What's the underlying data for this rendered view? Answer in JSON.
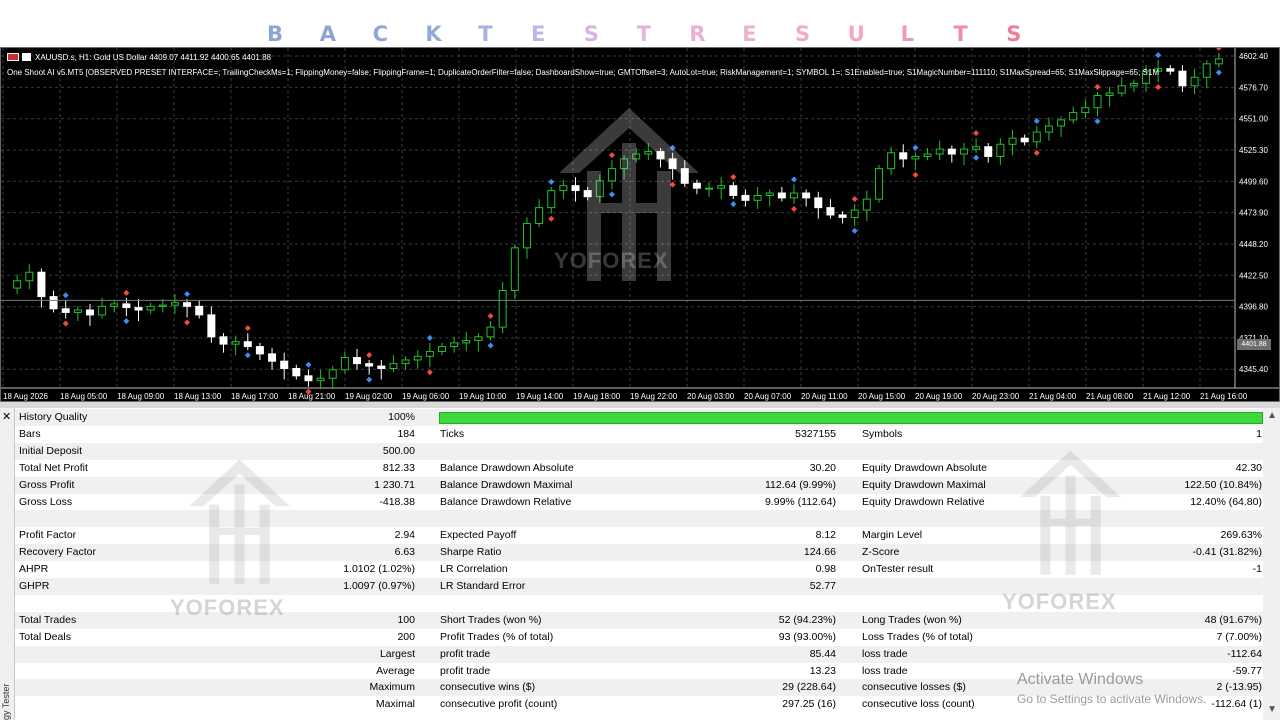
{
  "banner": {
    "letters": [
      "B",
      "A",
      "C",
      "K",
      "T",
      "E",
      "S",
      "T",
      "R",
      "E",
      "S",
      "U",
      "L",
      "T",
      "S"
    ],
    "colors": [
      "#8ba4d4",
      "#8ba4d4",
      "#92a6d8",
      "#9aa7da",
      "#a8b0dc",
      "#c2b4e0",
      "#d6b4e0",
      "#e6b4d8",
      "#eab2d2",
      "#efb0cc",
      "#f2aac6",
      "#f6a6bd",
      "#f39ab0",
      "#ef8ea4",
      "#ec8098"
    ]
  },
  "chart": {
    "symbol_line": "XAUUSD.s, H1:  Gold US Dollar  4409.07 4411.92 4400.65 4401.88",
    "ea_line": "One Shoot AI v5.MT5 [OBSERVED PRESET INTERFACE=; TrailingCheckMs=1; FlippingMoney=false; FlippingFrame=1; DuplicateOrderFilter=false; DashboardShow=true; GMTOffset=3; AutoLot=true; RiskManagement=1; SYMBOL 1=; S1Enabled=true; S1MagicNumber=111110; S1MaxSpread=65; S1MaxSlippage=65; S1M",
    "price_badge": "4401.88",
    "price_ticks": [
      "4602.40",
      "4576.70",
      "4551.00",
      "4525.30",
      "4499.60",
      "4473.90",
      "4448.20",
      "4422.50",
      "4396.80",
      "4371.10",
      "4345.40"
    ],
    "time_ticks": [
      "18 Aug 2026",
      "18 Aug 05:00",
      "18 Aug 09:00",
      "18 Aug 13:00",
      "18 Aug 17:00",
      "18 Aug 21:00",
      "19 Aug 02:00",
      "19 Aug 06:00",
      "19 Aug 10:00",
      "19 Aug 14:00",
      "19 Aug 18:00",
      "19 Aug 22:00",
      "20 Aug 03:00",
      "20 Aug 07:00",
      "20 Aug 11:00",
      "20 Aug 15:00",
      "20 Aug 19:00",
      "20 Aug 23:00",
      "21 Aug 04:00",
      "21 Aug 08:00",
      "21 Aug 12:00",
      "21 Aug 16:00"
    ],
    "watermark": "YOFOREX",
    "candle_close_path": [
      4412,
      4418,
      4425,
      4405,
      4395,
      4392,
      4394,
      4390,
      4397,
      4399,
      4396,
      4394,
      4397,
      4398,
      4400,
      4397,
      4390,
      4372,
      4366,
      4368,
      4364,
      4358,
      4352,
      4346,
      4340,
      4336,
      4338,
      4345,
      4355,
      4350,
      4348,
      4346,
      4350,
      4353,
      4356,
      4360,
      4364,
      4367,
      4369,
      4372,
      4380,
      4410,
      4445,
      4465,
      4478,
      4492,
      4496,
      4492,
      4487,
      4500,
      4510,
      4518,
      4522,
      4524,
      4518,
      4510,
      4498,
      4494,
      4494,
      4496,
      4488,
      4484,
      4488,
      4490,
      4486,
      4490,
      4486,
      4478,
      4472,
      4470,
      4476,
      4485,
      4510,
      4523,
      4518,
      4520,
      4522,
      4526,
      4522,
      4526,
      4528,
      4520,
      4530,
      4535,
      4532,
      4540,
      4545,
      4550,
      4556,
      4560,
      4570,
      4572,
      4578,
      4580,
      4590,
      4592,
      4590,
      4578,
      4585,
      4596,
      4600
    ],
    "colors": {
      "bull": "#22c12a",
      "bear": "#ffffff",
      "grid": "#3a3a3a",
      "buy_marker": "#3a8ef5",
      "sell_marker": "#f04a3a"
    }
  },
  "report": {
    "side_label": "gy Tester",
    "rows": [
      {
        "c1": [
          "History Quality",
          "100%"
        ],
        "c2": [
          "",
          ""
        ],
        "c3": [
          "",
          ""
        ],
        "bar": true
      },
      {
        "c1": [
          "Bars",
          "184"
        ],
        "c2": [
          "Ticks",
          "5327155"
        ],
        "c3": [
          "Symbols",
          "1"
        ]
      },
      {
        "c1": [
          "Initial Deposit",
          "500.00"
        ],
        "c2": [
          "",
          ""
        ],
        "c3": [
          "",
          ""
        ]
      },
      {
        "c1": [
          "Total Net Profit",
          "812.33"
        ],
        "c2": [
          "Balance Drawdown Absolute",
          "30.20"
        ],
        "c3": [
          "Equity Drawdown Absolute",
          "42.30"
        ]
      },
      {
        "c1": [
          "Gross Profit",
          "1 230.71"
        ],
        "c2": [
          "Balance Drawdown Maximal",
          "112.64 (9.99%)"
        ],
        "c3": [
          "Equity Drawdown Maximal",
          "122.50 (10.84%)"
        ]
      },
      {
        "c1": [
          "Gross Loss",
          "-418.38"
        ],
        "c2": [
          "Balance Drawdown Relative",
          "9.99% (112.64)"
        ],
        "c3": [
          "Equity Drawdown Relative",
          "12.40% (64.80)"
        ]
      },
      {
        "c1": [
          "",
          ""
        ],
        "c2": [
          "",
          ""
        ],
        "c3": [
          "",
          ""
        ]
      },
      {
        "c1": [
          "Profit Factor",
          "2.94"
        ],
        "c2": [
          "Expected Payoff",
          "8.12"
        ],
        "c3": [
          "Margin Level",
          "269.63%"
        ]
      },
      {
        "c1": [
          "Recovery Factor",
          "6.63"
        ],
        "c2": [
          "Sharpe Ratio",
          "124.66"
        ],
        "c3": [
          "Z-Score",
          "-0.41 (31.82%)"
        ]
      },
      {
        "c1": [
          "AHPR",
          "1.0102 (1.02%)"
        ],
        "c2": [
          "LR Correlation",
          "0.98"
        ],
        "c3": [
          "OnTester result",
          "-1"
        ]
      },
      {
        "c1": [
          "GHPR",
          "1.0097 (0.97%)"
        ],
        "c2": [
          "LR Standard Error",
          "52.77"
        ],
        "c3": [
          "",
          ""
        ]
      },
      {
        "c1": [
          "",
          ""
        ],
        "c2": [
          "",
          ""
        ],
        "c3": [
          "",
          ""
        ]
      },
      {
        "c1": [
          "Total Trades",
          "100"
        ],
        "c2": [
          "Short Trades (won %)",
          "52 (94.23%)"
        ],
        "c3": [
          "Long Trades (won %)",
          "48 (91.67%)"
        ]
      },
      {
        "c1": [
          "Total Deals",
          "200"
        ],
        "c2": [
          "Profit Trades (% of total)",
          "93 (93.00%)"
        ],
        "c3": [
          "Loss Trades (% of total)",
          "7 (7.00%)"
        ]
      },
      {
        "c1": [
          "",
          "Largest"
        ],
        "c2": [
          "profit trade",
          "85.44"
        ],
        "c3": [
          "loss trade",
          "-112.64"
        ]
      },
      {
        "c1": [
          "",
          "Average"
        ],
        "c2": [
          "profit trade",
          "13.23"
        ],
        "c3": [
          "loss trade",
          "-59.77"
        ]
      },
      {
        "c1": [
          "",
          "Maximum"
        ],
        "c2": [
          "consecutive wins ($)",
          "29 (228.64)"
        ],
        "c3": [
          "consecutive losses ($)",
          "2 (-13.95)"
        ]
      },
      {
        "c1": [
          "",
          "Maximal"
        ],
        "c2": [
          "consecutive profit (count)",
          "297.25 (16)"
        ],
        "c3": [
          "consecutive loss (count)",
          "-112.64 (1)"
        ]
      }
    ],
    "watermark": "YOFOREX",
    "activate_title": "Activate Windows",
    "activate_sub": "Go to Settings to activate Windows."
  }
}
